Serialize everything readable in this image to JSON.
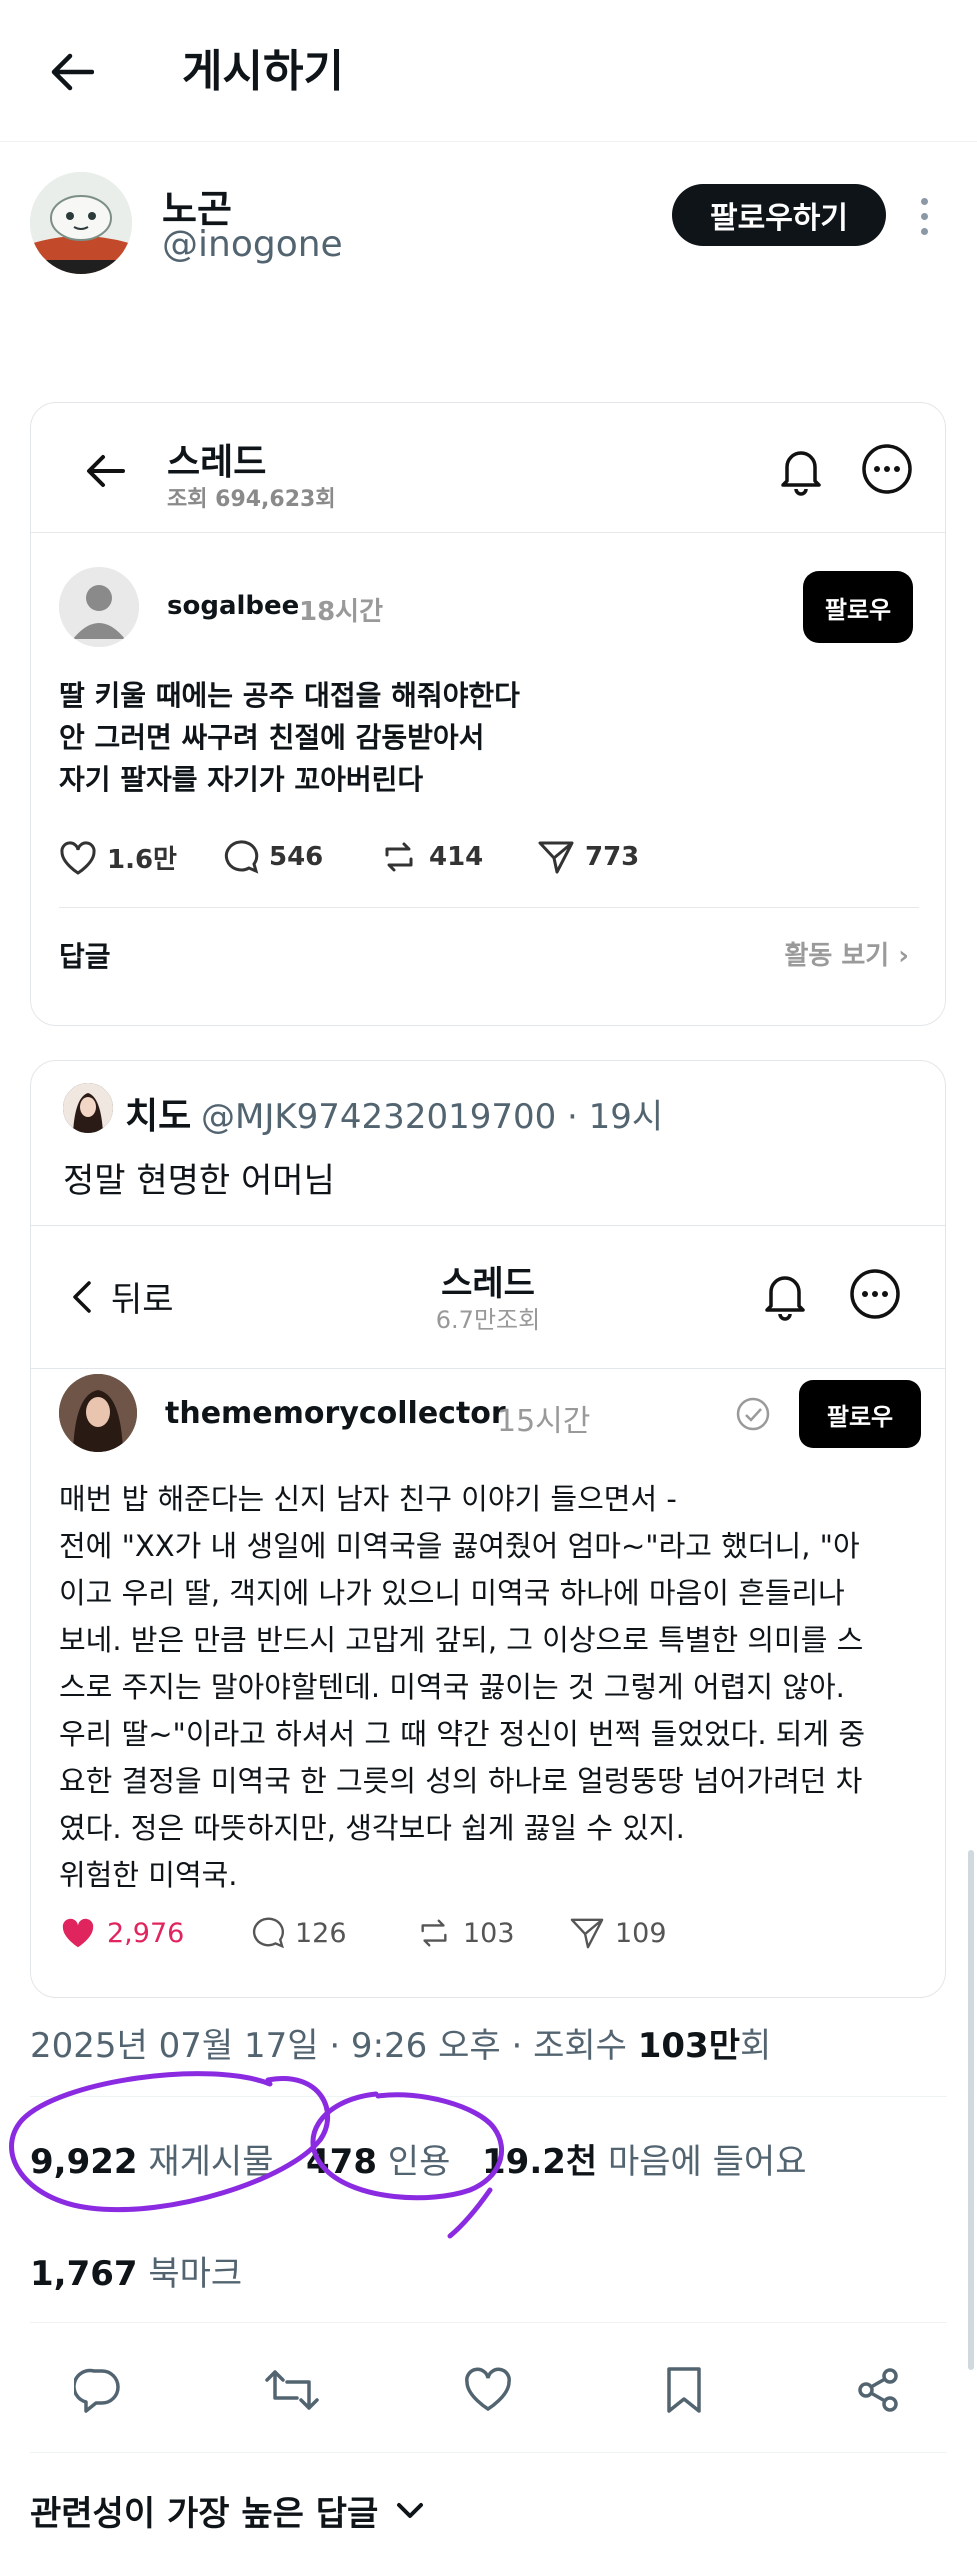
{
  "header": {
    "title": "게시하기"
  },
  "author": {
    "name": "노곤",
    "handle": "@inogone",
    "follow_label": "팔로우하기"
  },
  "card1": {
    "title": "스레드",
    "views": "조회 694,623회",
    "user": "sogalbee",
    "time": "18시간",
    "follow_label": "팔로우",
    "lines": [
      "딸 키울 때에는 공주 대접을 해줘야한다",
      "안 그러면 싸구려 친절에 감동받아서",
      "자기 팔자를 자기가 꼬아버린다"
    ],
    "likes": "1.6만",
    "comments": "546",
    "reposts": "414",
    "shares": "773",
    "reply_label": "답글",
    "activity_label": "활동 보기"
  },
  "quote": {
    "name": "치도",
    "meta": "@MJK974232019700 · 19시",
    "text": "정말 현명한 어머님",
    "inner": {
      "back_label": "뒤로",
      "title": "스레드",
      "views": "6.7만조회",
      "user": "thememorycollector",
      "time": "15시간",
      "follow_label": "팔로우",
      "lines": [
        "매번 밥 해준다는 신지 남자 친구 이야기 들으면서 -",
        "전에 \"XX가 내 생일에 미역국을 끓여줬어 엄마~\"라고 했더니, \"아",
        "이고 우리 딸, 객지에 나가 있으니 미역국 하나에 마음이 흔들리나",
        "보네. 받은 만큼 반드시 고맙게 갚되, 그 이상으로 특별한 의미를 스",
        "스로 주지는 말아야할텐데. 미역국 끓이는 것 그렇게 어렵지 않아.",
        "우리 딸~\"이라고 하셔서 그 때 약간 정신이 번쩍 들었었다. 되게 중",
        "요한 결정을 미역국 한 그릇의 성의 하나로 얼렁뚱땅 넘어가려던 차",
        "였다. 정은 따뜻하지만, 생각보다 쉽게 끓일 수 있지.",
        "위험한 미역국."
      ],
      "likes": "2,976",
      "comments": "126",
      "reposts": "103",
      "shares": "109"
    }
  },
  "meta": {
    "date": "2025년 07월 17일 · 9:26 오후 · 조회수 ",
    "views_num": "103만",
    "views_suffix": "회"
  },
  "stats": {
    "reposts_num": "9,922",
    "reposts_label": "재게시물",
    "quotes_num": "478",
    "quotes_label": "인용",
    "likes_num": "19.2천",
    "likes_label": "마음에 들어요",
    "bookmarks_num": "1,767",
    "bookmarks_label": "북마크"
  },
  "replies_sort": "관련성이 가장 높은 답글",
  "colors": {
    "accent_like": "#e0245e",
    "annotation": "#8a2be2",
    "text": "#0f1419",
    "muted": "#536471"
  }
}
